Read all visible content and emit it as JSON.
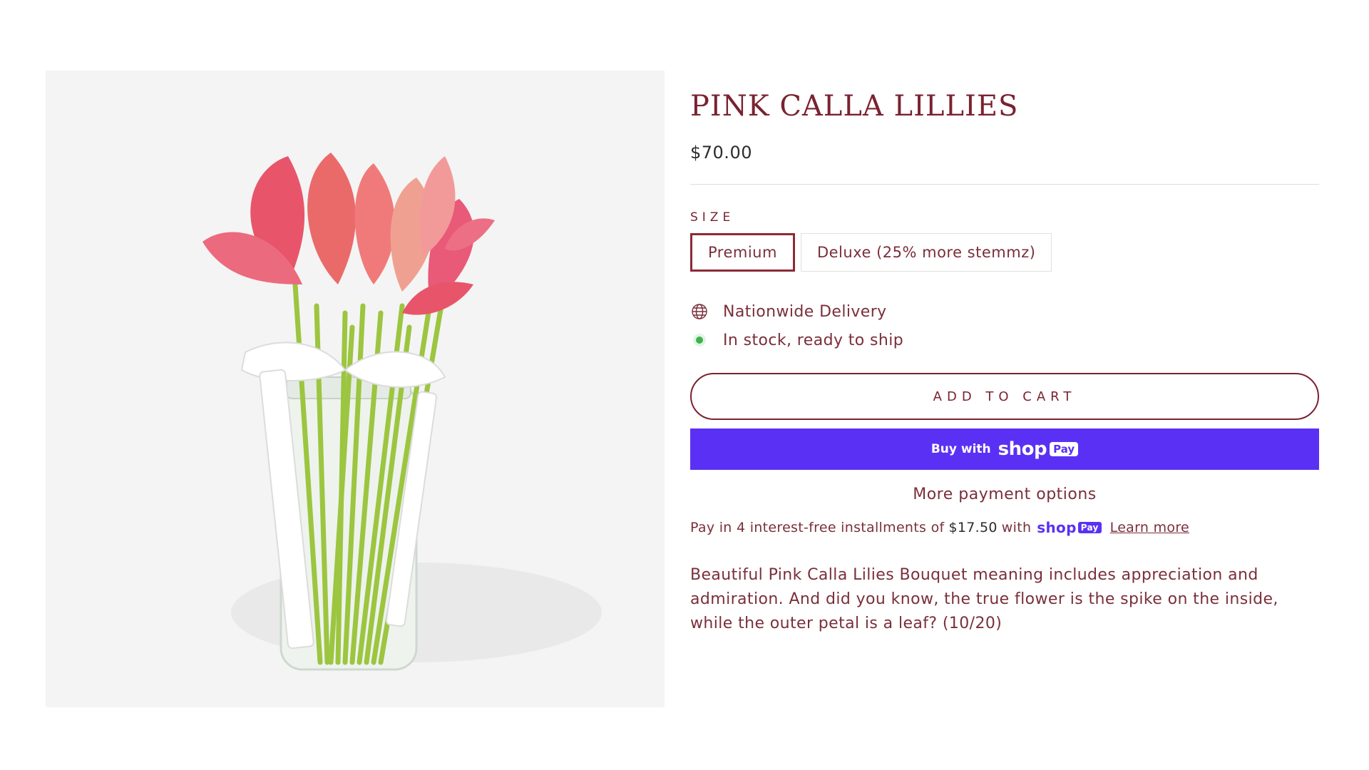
{
  "product": {
    "title": "PINK CALLA LILLIES",
    "price": "$70.00",
    "image_alt": "Pink calla lilies in a glass mason jar tied with STEMMZ ribbon"
  },
  "size": {
    "label": "SIZE",
    "options": [
      {
        "label": "Premium",
        "selected": true
      },
      {
        "label": "Deluxe (25% more stemmz)",
        "selected": false
      }
    ]
  },
  "info": {
    "delivery": {
      "icon": "globe-icon",
      "text": "Nationwide Delivery"
    },
    "stock": {
      "icon": "in-stock-dot-icon",
      "text": "In stock, ready to ship",
      "color": "#3bb54a"
    }
  },
  "buttons": {
    "add_to_cart": "ADD TO CART",
    "shop_pay_prefix": "Buy with",
    "shop_pay_logo": "shop",
    "shop_pay_pill": "Pay",
    "more_options": "More payment options"
  },
  "installments": {
    "prefix": "Pay in 4 interest-free installments of",
    "amount": "$17.50",
    "with": "with",
    "logo": "shop",
    "pill": "Pay",
    "learn_more": "Learn more"
  },
  "description": "Beautiful Pink Calla Lilies Bouquet meaning includes appreciation and admiration. And did you know, the true flower is the spike on the inside, while the outer petal is a leaf? (10/20)",
  "colors": {
    "accent": "#7a2230",
    "shop_pay": "#5a31f4",
    "image_bg": "#f4f4f4"
  }
}
